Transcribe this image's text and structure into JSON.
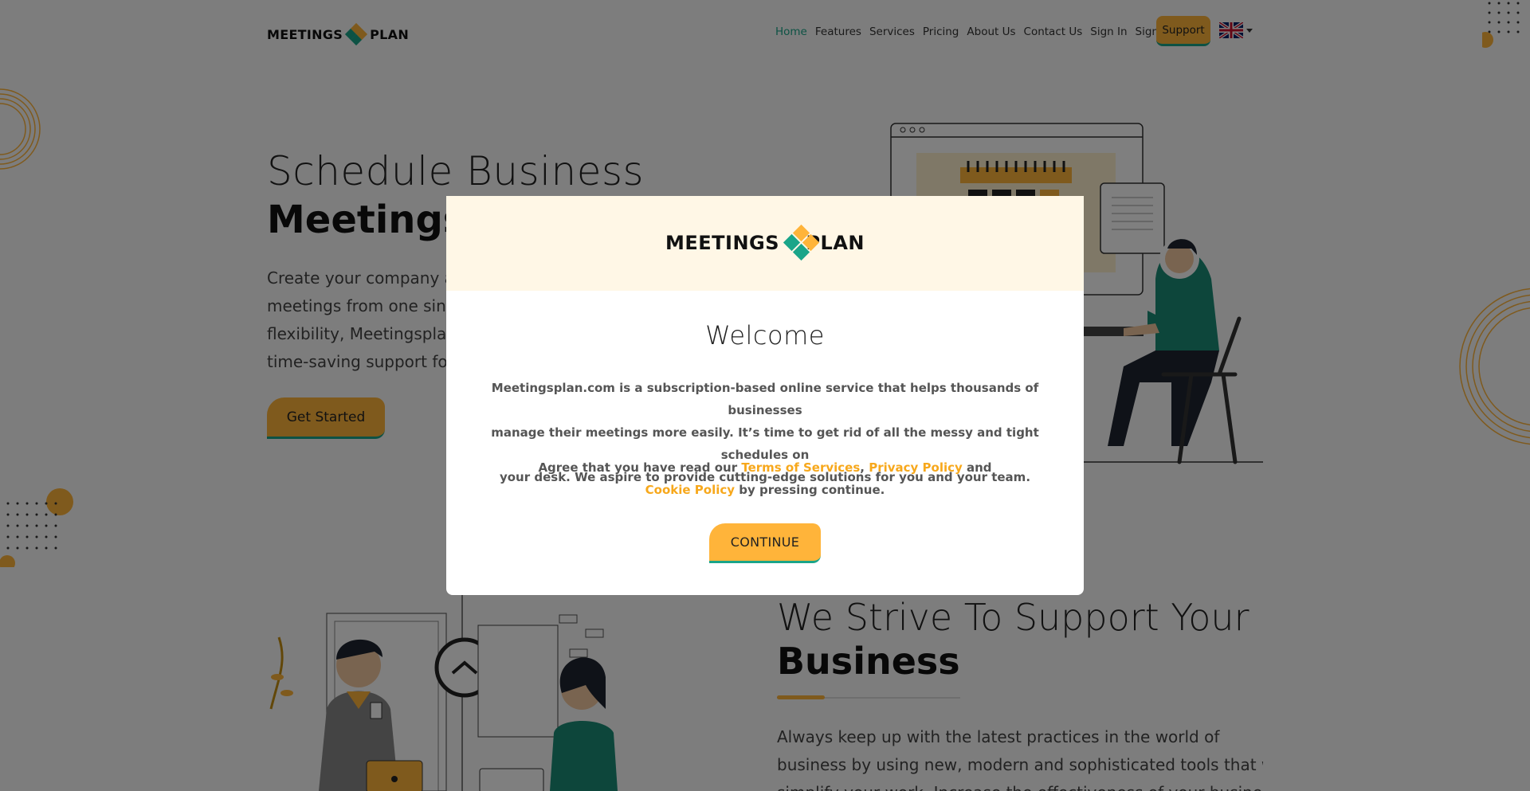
{
  "header": {
    "logo_left": "MEETINGS",
    "logo_right": "PLAN",
    "nav": [
      "Home",
      "Features",
      "Services",
      "Pricing",
      "About Us",
      "Contact Us",
      "Sign In",
      "Sign Up"
    ],
    "support_label": "Support",
    "language_icon": "uk-flag-icon"
  },
  "hero": {
    "title_light": "Schedule Business",
    "title_bold": "Meetings",
    "text_lines": [
      "Create your company a",
      "meetings from one sing",
      "flexibility, Meetingsplan",
      "time-saving support for"
    ],
    "cta_label": "Get Started"
  },
  "support_section": {
    "title_light": "We Strive To Support Your",
    "title_bold": "Business",
    "text_lines": [
      "Always keep up with the latest practices in the world of",
      "business by using new, modern and sophisticated tools that will",
      "simplify your work. Increase the effectiveness of your business"
    ]
  },
  "modal": {
    "logo_left": "MEETINGS",
    "logo_right": "PLAN",
    "title": "Welcome",
    "description_lines": [
      "Meetingsplan.com is a subscription-based online service that helps thousands of businesses",
      "manage their meetings more easily. It’s time to get rid of all the messy and tight schedules on",
      "your desk. We aspire to provide cutting-edge solutions for you and your team."
    ],
    "agree_prefix": "Agree that you have read our ",
    "terms_link": "Terms of Services",
    "comma": ",",
    "privacy_link": "Privacy Policy",
    "and": " and",
    "cookie_link": "Cookie Policy",
    "agree_suffix": " by pressing continue.",
    "continue_label": "CONTINUE"
  },
  "colors": {
    "accent": "#ffb43a",
    "teal": "#1aa589",
    "modal_header_bg": "#fff7e6",
    "overlay": "rgba(0,0,0,0.5)"
  }
}
